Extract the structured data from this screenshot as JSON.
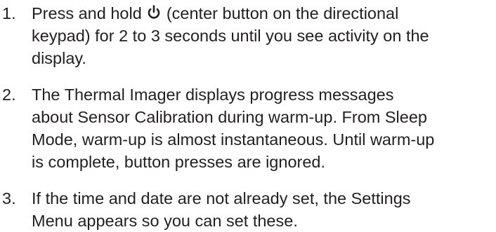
{
  "steps": [
    {
      "number": "1.",
      "text_before_icon": "Press and hold ",
      "icon": "power-icon",
      "line1_after_icon": " (center button on the directional",
      "line2": "keypad) for 2 to 3 seconds until you see activity on the",
      "line3": "display."
    },
    {
      "number": "2.",
      "line1": "The Thermal Imager displays progress messages",
      "line2": "about Sensor Calibration during warm-up. From Sleep",
      "line3": "Mode, warm-up is almost instantaneous. Until warm-up",
      "line4": "is complete, button presses are ignored."
    },
    {
      "number": "3.",
      "line1": "If the time and date are not already set, the Settings",
      "line2": "Menu appears so you can set these."
    }
  ]
}
